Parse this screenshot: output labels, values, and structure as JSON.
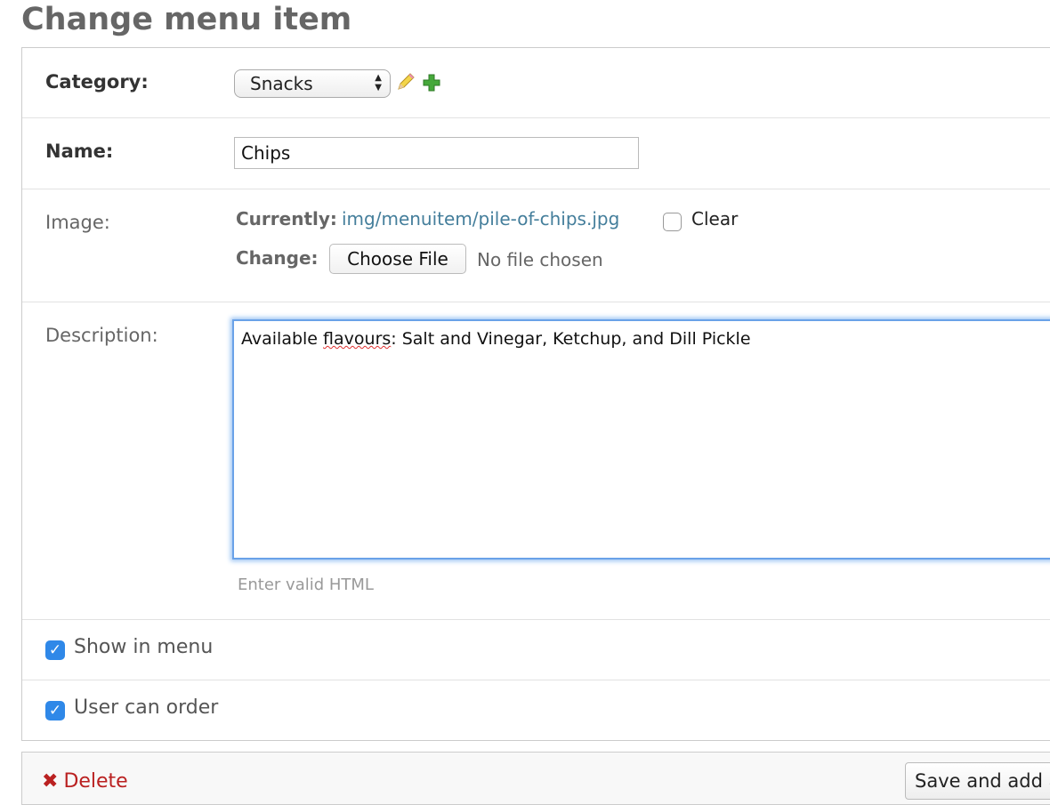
{
  "page": {
    "title": "Change menu item"
  },
  "category": {
    "label": "Category:",
    "selected": "Snacks"
  },
  "name": {
    "label": "Name:",
    "value": "Chips"
  },
  "image": {
    "label": "Image:",
    "currently_label": "Currently:",
    "current_file": "img/menuitem/pile-of-chips.jpg",
    "clear_label": "Clear",
    "change_label": "Change:",
    "choose_button": "Choose File",
    "no_file_text": "No file chosen"
  },
  "description": {
    "label": "Description:",
    "value_before": "Available ",
    "value_misspelled": "flavours",
    "value_after": ": Salt and Vinegar, Ketchup, and Dill Pickle",
    "help_text": "Enter valid HTML"
  },
  "show_in_menu": {
    "label": "Show in menu",
    "checked": true
  },
  "user_can_order": {
    "label": "User can order",
    "checked": true
  },
  "submit": {
    "delete_label": "Delete",
    "save_add_label": "Save and add another"
  }
}
